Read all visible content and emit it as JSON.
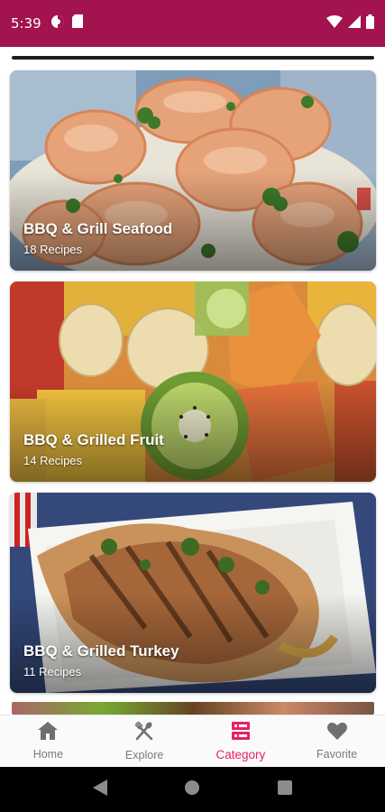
{
  "status_bar": {
    "time": "5:39",
    "icons_left": [
      "data-saver-icon",
      "sim-card-icon"
    ],
    "icons_right": [
      "wifi-icon",
      "signal-icon",
      "battery-icon"
    ]
  },
  "categories": [
    {
      "title": "BBQ & Grill Seafood",
      "count": "18 Recipes",
      "image": "grilled-shrimp-photo"
    },
    {
      "title": "BBQ & Grilled Fruit",
      "count": "14 Recipes",
      "image": "fruit-skewers-photo"
    },
    {
      "title": "BBQ & Grilled Turkey",
      "count": "11 Recipes",
      "image": "grilled-turkey-photo"
    }
  ],
  "bottom_nav": {
    "items": [
      {
        "label": "Home",
        "icon": "home-icon",
        "active": false
      },
      {
        "label": "Explore",
        "icon": "fork-knife-icon",
        "active": false
      },
      {
        "label": "Category",
        "icon": "category-list-icon",
        "active": true
      },
      {
        "label": "Favorite",
        "icon": "heart-icon",
        "active": false
      }
    ]
  },
  "colors": {
    "status_bar": "#a2134f",
    "accent": "#e91e63",
    "nav_inactive": "#7a7a7a"
  }
}
